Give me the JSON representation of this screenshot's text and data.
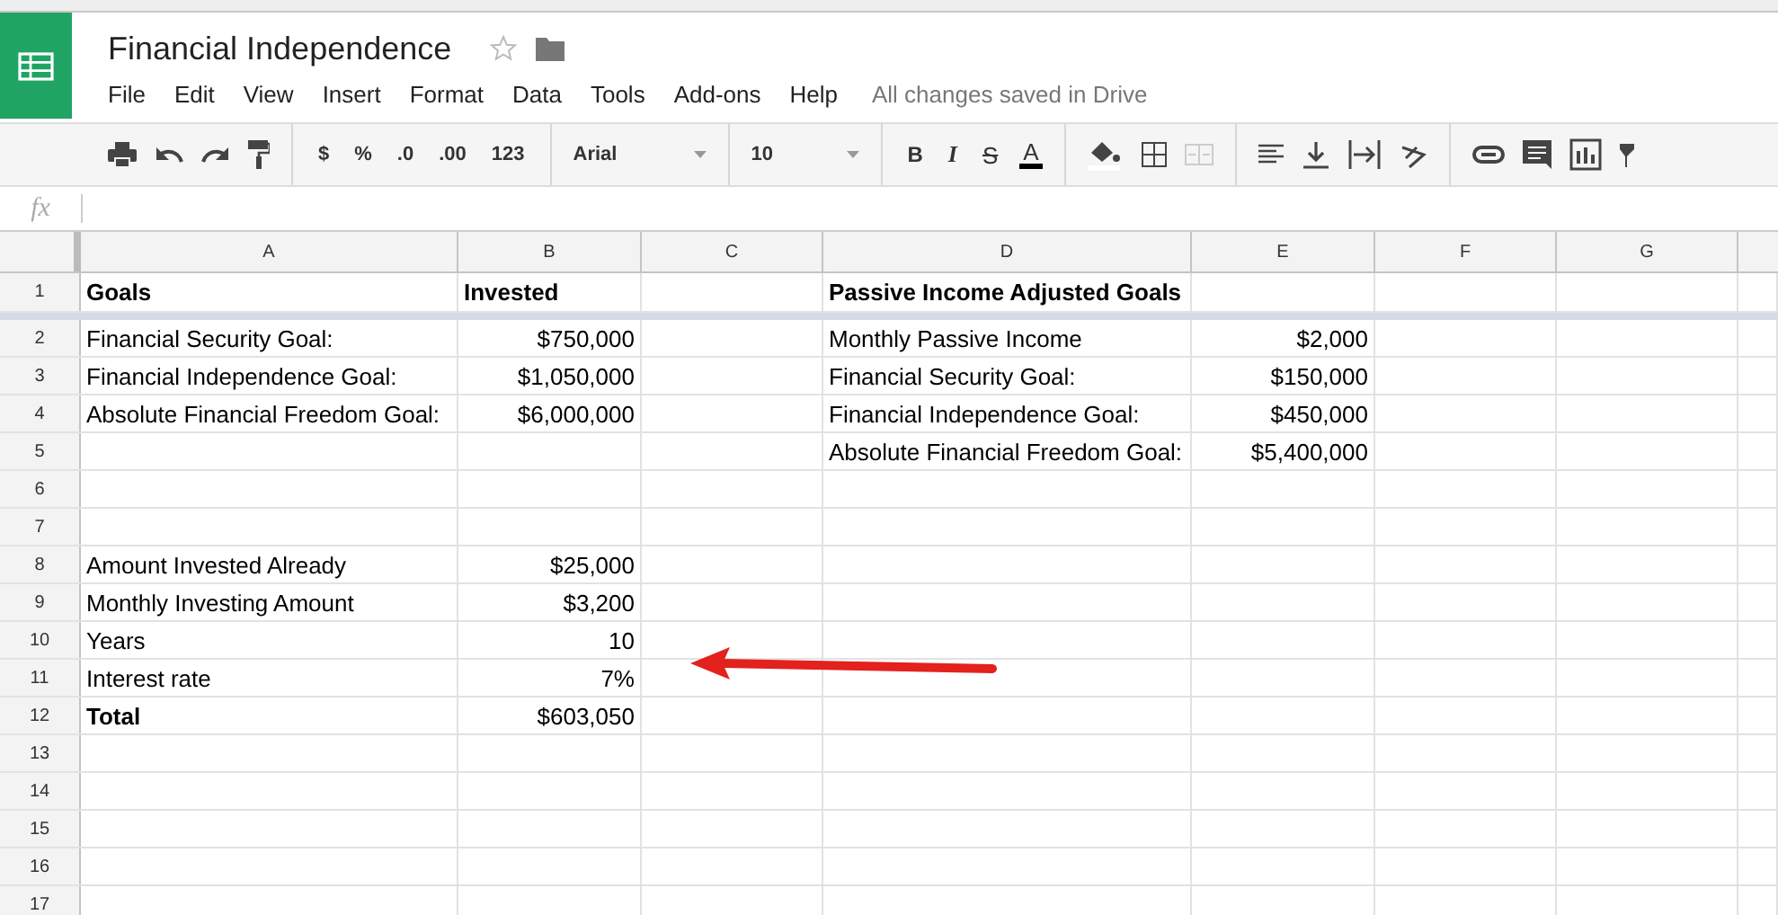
{
  "document": {
    "title": "Financial Independence",
    "status": "All changes saved in Drive"
  },
  "menu": [
    "File",
    "Edit",
    "View",
    "Insert",
    "Format",
    "Data",
    "Tools",
    "Add-ons",
    "Help"
  ],
  "toolbar": {
    "format_buttons": [
      "$",
      "%",
      ".0",
      ".00",
      "123"
    ],
    "font": "Arial",
    "font_size": "10",
    "style_buttons": [
      "B",
      "I",
      "S",
      "A"
    ]
  },
  "formula_bar": {
    "label": "fx"
  },
  "columns": [
    "A",
    "B",
    "C",
    "D",
    "E",
    "F",
    "G"
  ],
  "rows": [
    {
      "number": "1",
      "cells": [
        {
          "text": "Goals",
          "kind": "label",
          "bold": true
        },
        {
          "text": "Invested",
          "kind": "label",
          "bold": true
        },
        {},
        {
          "text": "Passive Income Adjusted Goals",
          "kind": "label",
          "bold": true
        },
        {},
        {},
        {}
      ]
    },
    {
      "number": "2",
      "cells": [
        {
          "text": "Financial Security Goal:",
          "kind": "label",
          "bold": false
        },
        {
          "text": "$750,000",
          "kind": "number",
          "bold": false
        },
        {},
        {
          "text": "Monthly Passive Income",
          "kind": "label",
          "bold": false
        },
        {
          "text": "$2,000",
          "kind": "number",
          "bold": false
        },
        {},
        {}
      ]
    },
    {
      "number": "3",
      "cells": [
        {
          "text": "Financial Independence Goal:",
          "kind": "label",
          "bold": false
        },
        {
          "text": "$1,050,000",
          "kind": "number",
          "bold": false
        },
        {},
        {
          "text": "Financial Security Goal:",
          "kind": "label",
          "bold": false
        },
        {
          "text": "$150,000",
          "kind": "number",
          "bold": false
        },
        {},
        {}
      ]
    },
    {
      "number": "4",
      "cells": [
        {
          "text": "Absolute Financial Freedom Goal:",
          "kind": "label",
          "bold": false
        },
        {
          "text": "$6,000,000",
          "kind": "number",
          "bold": false
        },
        {},
        {
          "text": "Financial Independence Goal:",
          "kind": "label",
          "bold": false
        },
        {
          "text": "$450,000",
          "kind": "number",
          "bold": false
        },
        {},
        {}
      ]
    },
    {
      "number": "5",
      "cells": [
        {},
        {},
        {},
        {
          "text": "Absolute Financial Freedom Goal:",
          "kind": "label",
          "bold": false
        },
        {
          "text": "$5,400,000",
          "kind": "number",
          "bold": false
        },
        {},
        {}
      ]
    },
    {
      "number": "6",
      "cells": [
        {},
        {},
        {},
        {},
        {},
        {},
        {}
      ]
    },
    {
      "number": "7",
      "cells": [
        {},
        {},
        {},
        {},
        {},
        {},
        {}
      ]
    },
    {
      "number": "8",
      "cells": [
        {
          "text": "Amount Invested Already",
          "kind": "label",
          "bold": false
        },
        {
          "text": "$25,000",
          "kind": "number",
          "bold": false
        },
        {},
        {},
        {},
        {},
        {}
      ]
    },
    {
      "number": "9",
      "cells": [
        {
          "text": "Monthly Investing Amount",
          "kind": "label",
          "bold": false
        },
        {
          "text": "$3,200",
          "kind": "number",
          "bold": false
        },
        {},
        {},
        {},
        {},
        {}
      ]
    },
    {
      "number": "10",
      "cells": [
        {
          "text": "Years",
          "kind": "label",
          "bold": false
        },
        {
          "text": "10",
          "kind": "number",
          "bold": false
        },
        {},
        {},
        {},
        {},
        {}
      ]
    },
    {
      "number": "11",
      "cells": [
        {
          "text": "Interest rate",
          "kind": "label",
          "bold": false
        },
        {
          "text": "7%",
          "kind": "number",
          "bold": false
        },
        {},
        {},
        {},
        {},
        {}
      ]
    },
    {
      "number": "12",
      "cells": [
        {
          "text": "Total",
          "kind": "label",
          "bold": true
        },
        {
          "text": "$603,050",
          "kind": "number",
          "bold": false
        },
        {},
        {},
        {},
        {},
        {}
      ]
    },
    {
      "number": "13",
      "cells": [
        {},
        {},
        {},
        {},
        {},
        {},
        {}
      ]
    },
    {
      "number": "14",
      "cells": [
        {},
        {},
        {},
        {},
        {},
        {},
        {}
      ]
    },
    {
      "number": "15",
      "cells": [
        {},
        {},
        {},
        {},
        {},
        {},
        {}
      ]
    },
    {
      "number": "16",
      "cells": [
        {},
        {},
        {},
        {},
        {},
        {},
        {}
      ]
    },
    {
      "number": "17",
      "cells": [
        {},
        {},
        {},
        {},
        {},
        {},
        {}
      ]
    }
  ]
}
